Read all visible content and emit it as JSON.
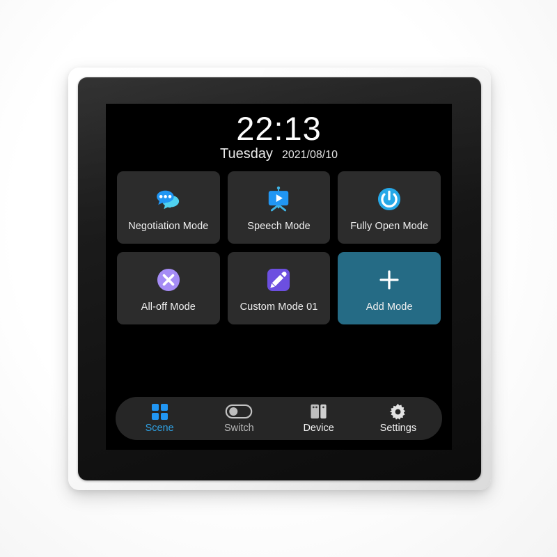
{
  "device": {
    "type": "smart-home-wall-panel",
    "frame_color": "#f2f2f2",
    "bezel_color": "#141414",
    "screen_color": "#000000"
  },
  "clock": {
    "time": "22:13",
    "weekday": "Tuesday",
    "date": "2021/08/10"
  },
  "scenes": [
    {
      "label": "Negotiation Mode",
      "icon": "chat-bubbles-icon",
      "icon_colors": [
        "#2196f3",
        "#4fd1ef"
      ],
      "tile_color": "#2c2c2c",
      "highlight": false
    },
    {
      "label": "Speech Mode",
      "icon": "presentation-board-icon",
      "icon_colors": [
        "#2196f3",
        "#3fb4e6"
      ],
      "tile_color": "#2c2c2c",
      "highlight": false
    },
    {
      "label": "Fully Open Mode",
      "icon": "power-icon",
      "icon_colors": [
        "#26a8e8",
        "#ffffff"
      ],
      "tile_color": "#2c2c2c",
      "highlight": false
    },
    {
      "label": "All-off Mode",
      "icon": "close-circle-icon",
      "icon_colors": [
        "#a58cf5",
        "#ffffff"
      ],
      "tile_color": "#2c2c2c",
      "highlight": false
    },
    {
      "label": "Custom Mode 01",
      "icon": "pencil-icon",
      "icon_colors": [
        "#6c4fe0",
        "#ffffff"
      ],
      "tile_color": "#2c2c2c",
      "highlight": false
    },
    {
      "label": "Add Mode",
      "icon": "plus-icon",
      "icon_colors": [
        "#ffffff"
      ],
      "tile_color": "#256b85",
      "highlight": true
    }
  ],
  "nav": {
    "active": "Scene",
    "items": [
      {
        "label": "Scene",
        "icon": "grid-icon",
        "state": "active",
        "color": "#2f9fe0"
      },
      {
        "label": "Switch",
        "icon": "toggle-icon",
        "state": "inactive",
        "color": "#b9b9b9"
      },
      {
        "label": "Device",
        "icon": "device-icon",
        "state": "inactive",
        "color": "#f2f2f2"
      },
      {
        "label": "Settings",
        "icon": "gear-icon",
        "state": "inactive",
        "color": "#f2f2f2"
      }
    ]
  }
}
